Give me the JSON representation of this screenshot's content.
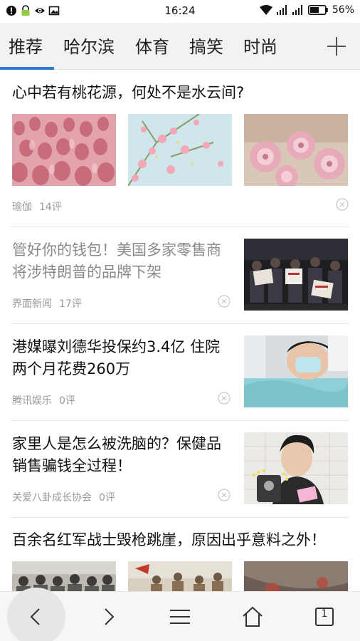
{
  "status_bar": {
    "time": "16:24",
    "battery": "56%",
    "icons_left": [
      "notification-icon",
      "lock-icon",
      "eye-icon",
      "image-icon"
    ],
    "icons_right": [
      "wifi-icon",
      "signal-icon",
      "signal-icon",
      "battery-icon"
    ]
  },
  "tabs": [
    {
      "label": "推荐",
      "active": true
    },
    {
      "label": "哈尔滨",
      "active": false
    },
    {
      "label": "体育",
      "active": false
    },
    {
      "label": "搞笑",
      "active": false
    },
    {
      "label": "时尚",
      "active": false
    }
  ],
  "accent_color": "#2e7bdb",
  "articles": [
    {
      "title": "心中若有桃花源，何处不是水云间?",
      "source": "瑜伽",
      "comments": "14评",
      "read": false,
      "layout": "three-images",
      "images": [
        "pink-tulip-field",
        "pink-blossoms-sky",
        "pink-cherry-blossoms"
      ]
    },
    {
      "title": "管好你的钱包！美国多家零售商将涉特朗普的品牌下架",
      "source": "界面新闻",
      "comments": "17评",
      "read": true,
      "layout": "right-image",
      "images": [
        "street-protest-night"
      ]
    },
    {
      "title": "港媒曝刘德华投保约3.4亿 住院两个月花费260万",
      "source": "腾讯娱乐",
      "comments": "0评",
      "read": false,
      "layout": "right-image",
      "images": [
        "man-in-hospital-bed"
      ]
    },
    {
      "title": "家里人是怎么被洗脑的？保健品销售骗钱全过程！",
      "source": "关爱八卦成长协会",
      "comments": "0评",
      "read": false,
      "layout": "right-image",
      "images": [
        "young-man-selfie"
      ]
    },
    {
      "title": "百余名红军战士毁枪跳崖，原因出乎意料之外！",
      "source": "",
      "comments": "",
      "read": false,
      "layout": "three-images",
      "images": [
        "historic-soldiers-photo",
        "historic-painting-figures",
        "historic-painting-dark"
      ]
    }
  ],
  "bottom_bar": {
    "buttons": [
      "back-icon",
      "forward-icon",
      "menu-icon",
      "home-icon",
      "tabs-icon"
    ],
    "tab_count": "1"
  }
}
